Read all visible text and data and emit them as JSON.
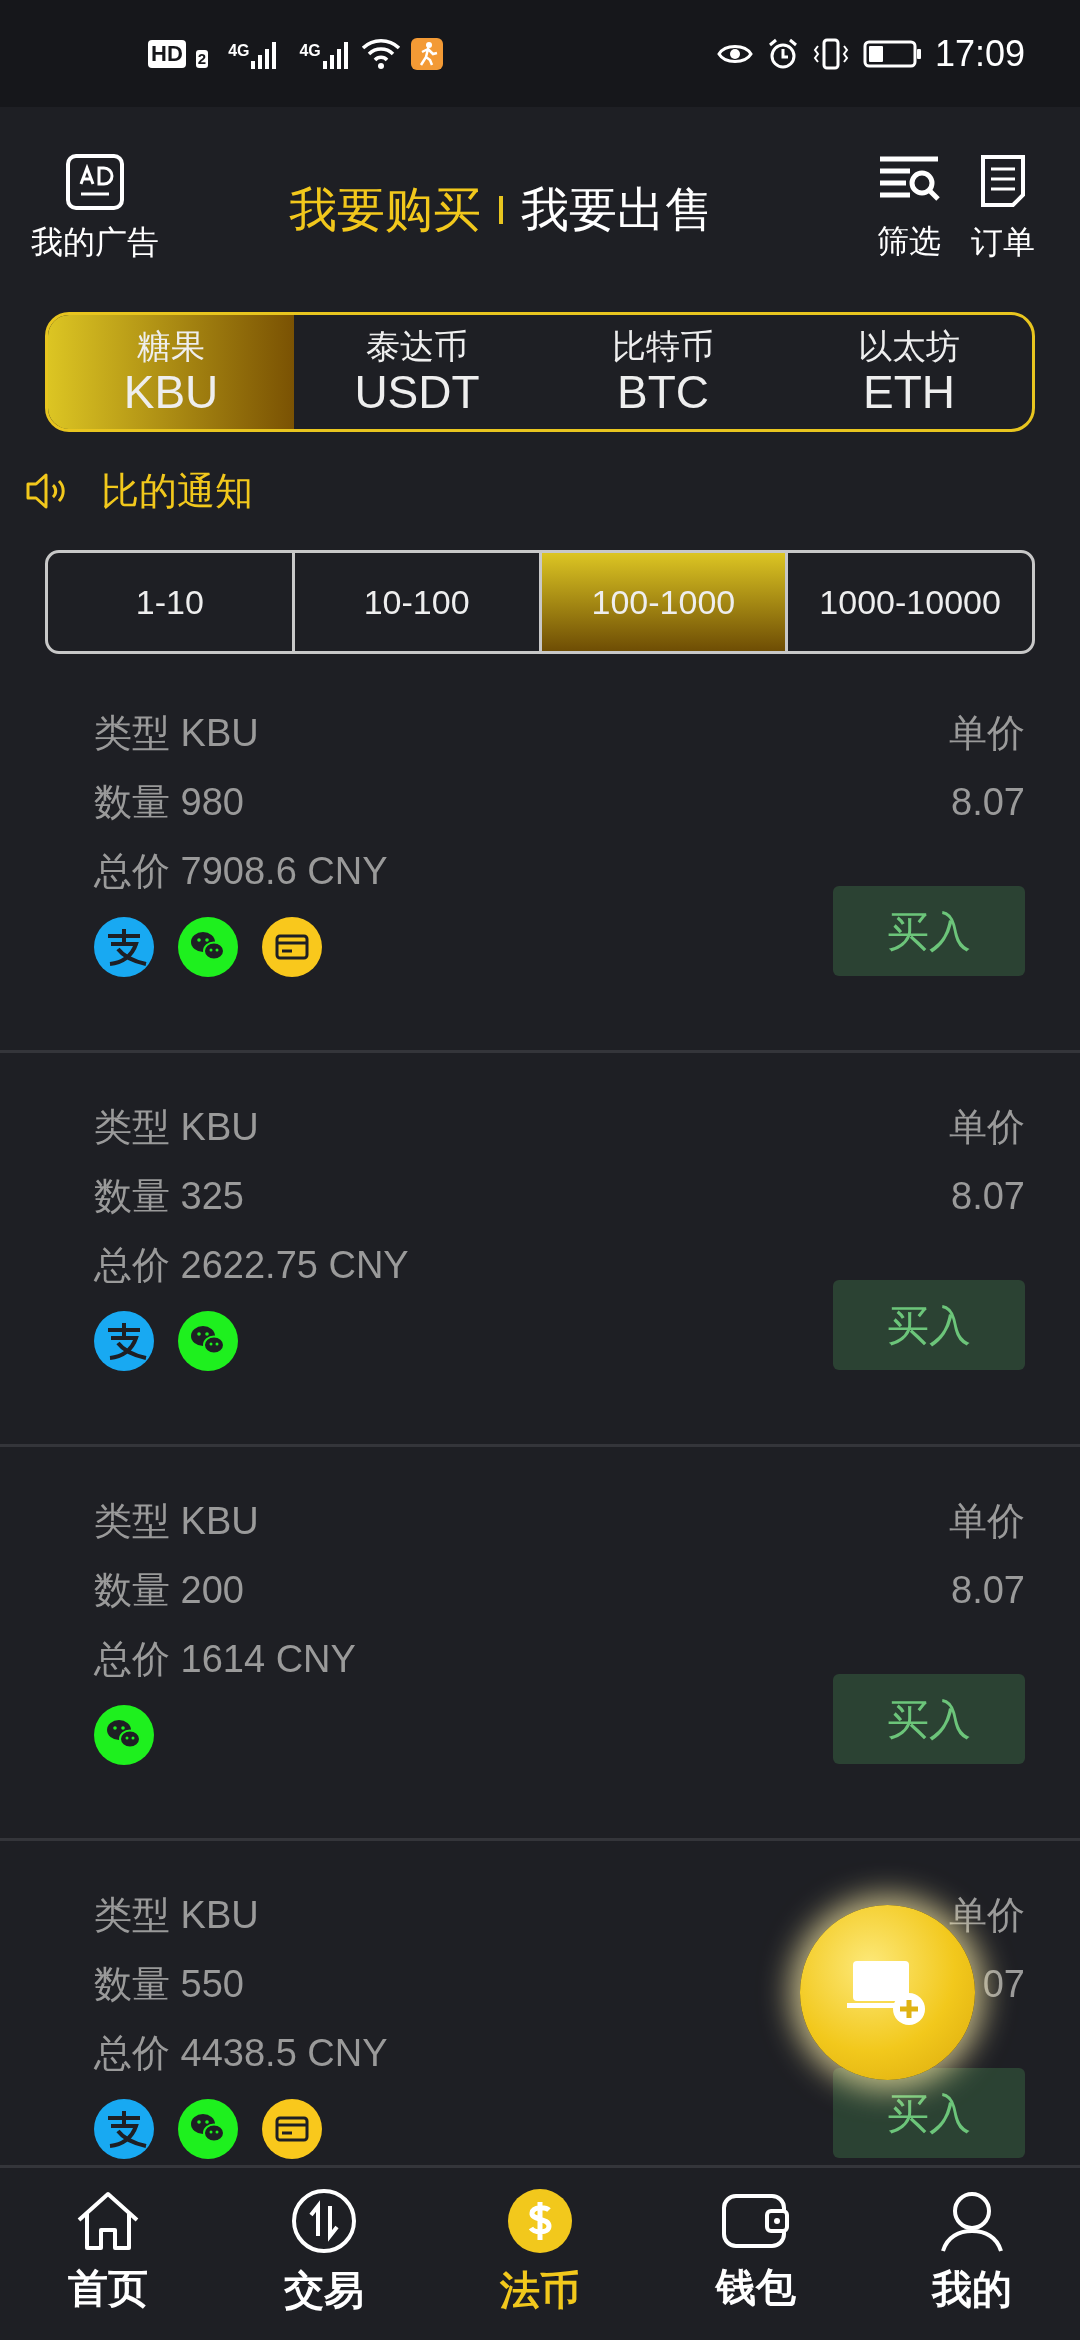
{
  "status_bar": {
    "hd": "HD",
    "sim": "2",
    "networks": [
      "4G",
      "4G"
    ],
    "time": "17:09"
  },
  "header": {
    "my_ads": "我的广告",
    "modes": [
      {
        "label": "我要购买",
        "selected": true
      },
      {
        "label": "我要出售",
        "selected": false
      }
    ],
    "actions": [
      {
        "kind": "filter",
        "label": "筛选"
      },
      {
        "kind": "orders",
        "label": "订单"
      }
    ]
  },
  "coins": [
    {
      "name": "糖果",
      "code": "KBU",
      "selected": true
    },
    {
      "name": "泰达币",
      "code": "USDT",
      "selected": false
    },
    {
      "name": "比特币",
      "code": "BTC",
      "selected": false
    },
    {
      "name": "以太坊",
      "code": "ETH",
      "selected": false
    }
  ],
  "notice": "比的通知",
  "ranges": [
    {
      "label": "1-10",
      "selected": false
    },
    {
      "label": "10-100",
      "selected": false
    },
    {
      "label": "100-1000",
      "selected": true
    },
    {
      "label": "1000-10000",
      "selected": false
    }
  ],
  "listings": [
    {
      "type": "类型 KBU",
      "quantity": "数量 980",
      "total": "总价 7908.6 CNY",
      "price_label": "单价",
      "price": "8.07",
      "payments": [
        {
          "kind": "alipay"
        },
        {
          "kind": "wechat"
        },
        {
          "kind": "card"
        }
      ],
      "button": "买入"
    },
    {
      "type": "类型 KBU",
      "quantity": "数量 325",
      "total": "总价 2622.75 CNY",
      "price_label": "单价",
      "price": "8.07",
      "payments": [
        {
          "kind": "alipay"
        },
        {
          "kind": "wechat"
        }
      ],
      "button": "买入"
    },
    {
      "type": "类型 KBU",
      "quantity": "数量 200",
      "total": "总价 1614 CNY",
      "price_label": "单价",
      "price": "8.07",
      "payments": [
        {
          "kind": "wechat"
        }
      ],
      "button": "买入"
    },
    {
      "type": "类型 KBU",
      "quantity": "数量 550",
      "total": "总价 4438.5 CNY",
      "price_label": "单价",
      "price": "07",
      "payments": [
        {
          "kind": "alipay"
        },
        {
          "kind": "wechat"
        },
        {
          "kind": "card"
        }
      ],
      "button": "买入"
    }
  ],
  "nav": [
    {
      "kind": "home",
      "label": "首页",
      "selected": false
    },
    {
      "kind": "trade",
      "label": "交易",
      "selected": false
    },
    {
      "kind": "fiat",
      "label": "法币",
      "selected": true
    },
    {
      "kind": "wallet",
      "label": "钱包",
      "selected": false
    },
    {
      "kind": "profile",
      "label": "我的",
      "selected": false
    }
  ]
}
